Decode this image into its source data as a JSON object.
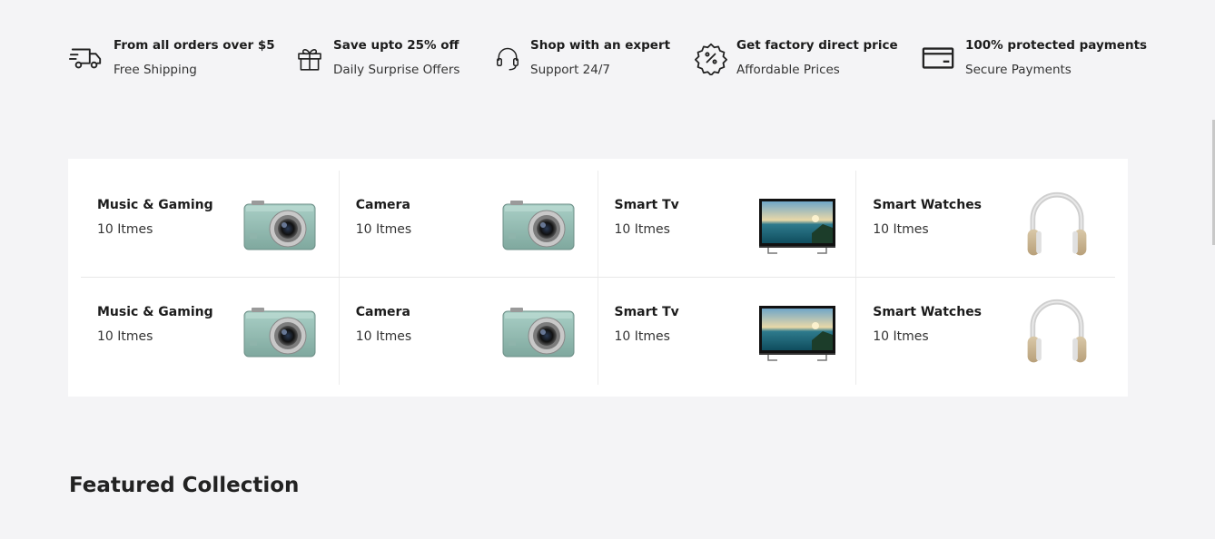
{
  "services": [
    {
      "icon": "truck-icon",
      "title": "From all orders over $5",
      "subtitle": "Free Shipping"
    },
    {
      "icon": "gift-icon",
      "title": "Save upto 25% off",
      "subtitle": "Daily Surprise Offers"
    },
    {
      "icon": "headset-icon",
      "title": "Shop with an expert",
      "subtitle": "Support 24/7"
    },
    {
      "icon": "discount-badge-icon",
      "title": "Get factory direct price",
      "subtitle": "Affordable Prices"
    },
    {
      "icon": "credit-card-icon",
      "title": "100% protected payments",
      "subtitle": "Secure Payments"
    }
  ],
  "categories": {
    "rows": [
      [
        {
          "name": "Music & Gaming",
          "count": "10 Itmes",
          "image": "camera"
        },
        {
          "name": "Camera",
          "count": "10 Itmes",
          "image": "camera"
        },
        {
          "name": "Smart Tv",
          "count": "10 Itmes",
          "image": "tv"
        },
        {
          "name": "Smart Watches",
          "count": "10 Itmes",
          "image": "headphones"
        }
      ],
      [
        {
          "name": "Music & Gaming",
          "count": "10 Itmes",
          "image": "camera"
        },
        {
          "name": "Camera",
          "count": "10 Itmes",
          "image": "camera"
        },
        {
          "name": "Smart Tv",
          "count": "10 Itmes",
          "image": "tv"
        },
        {
          "name": "Smart Watches",
          "count": "10 Itmes",
          "image": "headphones"
        }
      ]
    ]
  },
  "featured": {
    "title": "Featured Collection"
  }
}
